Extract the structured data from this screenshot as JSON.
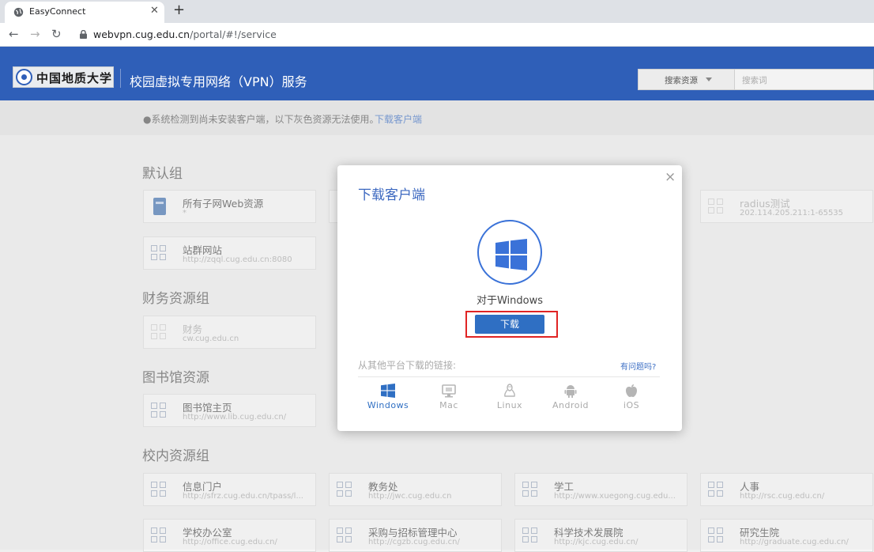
{
  "browser": {
    "tab_title": "EasyConnect",
    "tab_close": "✕",
    "new_tab": "+",
    "back": "←",
    "forward": "→",
    "reload": "↻",
    "url_host": "webvpn.cug.edu.cn",
    "url_path": "/portal/#!/service"
  },
  "header": {
    "logo_text": "中国地质大学",
    "title": "校园虚拟专用网络（VPN）服务",
    "search_select": "搜索资源",
    "search_placeholder": "搜索词"
  },
  "notice": {
    "text": "●系统检测到尚未安装客户端，以下灰色资源无法使用。",
    "link": "下载客户端"
  },
  "groups": [
    {
      "title": "默认组",
      "items": [
        {
          "name": "所有子网Web资源",
          "url": "*",
          "icon": "web-resource-icon"
        },
        {
          "name": "radius测试",
          "url": "202.114.205.211:1-65535",
          "icon": "grid-icon"
        },
        {
          "name": "站群网站",
          "url": "http://zqql.cug.edu.cn:8080",
          "icon": "grid-icon"
        }
      ]
    },
    {
      "title": "财务资源组",
      "items": [
        {
          "name": "财务",
          "url": "cw.cug.edu.cn",
          "icon": "grid-icon"
        }
      ]
    },
    {
      "title": "图书馆资源",
      "items": [
        {
          "name": "图书馆主页",
          "url": "http://www.lib.cug.edu.cn/",
          "icon": "grid-icon"
        }
      ]
    },
    {
      "title": "校内资源组",
      "items": [
        {
          "name": "信息门户",
          "url": "http://sfrz.cug.edu.cn/tpass/l...",
          "icon": "grid-icon"
        },
        {
          "name": "教务处",
          "url": "http://jwc.cug.edu.cn",
          "icon": "grid-icon"
        },
        {
          "name": "学工",
          "url": "http://www.xuegong.cug.edu...",
          "icon": "grid-icon"
        },
        {
          "name": "人事",
          "url": "http://rsc.cug.edu.cn/",
          "icon": "grid-icon"
        },
        {
          "name": "学校办公室",
          "url": "http://office.cug.edu.cn/",
          "icon": "grid-icon"
        },
        {
          "name": "采购与招标管理中心",
          "url": "http://cgzb.cug.edu.cn/",
          "icon": "grid-icon"
        },
        {
          "name": "科学技术发展院",
          "url": "http://kjc.cug.edu.cn/",
          "icon": "grid-icon"
        },
        {
          "name": "研究生院",
          "url": "http://graduate.cug.edu.cn/",
          "icon": "grid-icon"
        }
      ]
    }
  ],
  "modal": {
    "title": "下载客户端",
    "close": "×",
    "for_platform": "对于Windows",
    "download_button": "下载",
    "other_platforms_label": "从其他平台下载的链接:",
    "help_link": "有问题吗?",
    "platforms": [
      {
        "name": "Windows",
        "icon": "windows-icon",
        "active": true
      },
      {
        "name": "Mac",
        "icon": "mac-icon",
        "active": false
      },
      {
        "name": "Linux",
        "icon": "linux-icon",
        "active": false
      },
      {
        "name": "Android",
        "icon": "android-icon",
        "active": false
      },
      {
        "name": "iOS",
        "icon": "apple-icon",
        "active": false
      }
    ]
  },
  "colors": {
    "header_blue": "#2f5fb8",
    "accent_blue": "#2f6fc3",
    "highlight_red": "#e02424"
  }
}
